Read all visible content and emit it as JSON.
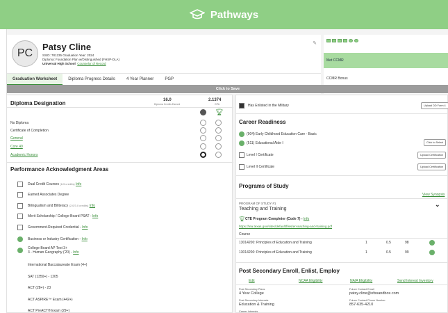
{
  "app": {
    "title": "Pathways"
  },
  "profile": {
    "initials": "PC",
    "name": "Patsy Cline",
    "line1": "SSID: 781235  Graduation Year: 2024",
    "line2": "Diploma: Foundation Plan w/Distinguished (FHSP-DLA)",
    "line3": "Universal High School",
    "counselor": "Counselor of Record"
  },
  "tabs": [
    "Graduation Worksheet",
    "Diploma Progress Details",
    "4 Year Planner",
    "PGP"
  ],
  "ccmr": {
    "met": "Met CCMR",
    "bonus": "CCMR Bonus"
  },
  "save": "Click to Save",
  "diploma": {
    "title": "Diploma Designation",
    "credits": "16.0",
    "credits_label": "Diploma Credits Earned",
    "gpa": "2.1374",
    "gpa_label": "GPA",
    "options": [
      "No Diploma",
      "Certificate of Completion",
      "General",
      "Core 40",
      "Academic Honors"
    ]
  },
  "pa": {
    "title": "Performance Acknowledgment Areas",
    "items": [
      {
        "label": "Dual Credit Courses",
        "sub": "(6.5 credits)",
        "link": "Info"
      },
      {
        "label": "Earned Associates Degree",
        "sub": "",
        "link": ""
      },
      {
        "label": "Bilingualism and Biliteracy",
        "sub": "(2.0/3.0 credits)",
        "link": "Info"
      },
      {
        "label": "Merit Scholarship / College Board PSAT -",
        "sub": "",
        "link": "Info"
      },
      {
        "label": "Government-Required Credential -",
        "sub": "",
        "link": "Info"
      },
      {
        "label": "Business or Industry Certification -",
        "sub": "",
        "link": "Info"
      },
      {
        "label": "College Board AP Test 3+",
        "sub": "",
        "link": ""
      },
      {
        "label": "3 - Human Geography ('20) -",
        "sub": "",
        "link": "Info"
      },
      {
        "label": "International Baccalaureate Exam (4+)",
        "sub": "",
        "link": ""
      },
      {
        "label": "SAT (1350+) - 1205",
        "sub": "",
        "link": ""
      },
      {
        "label": "ACT (28+) - 23",
        "sub": "",
        "link": ""
      },
      {
        "label": "ACT ASPIRE™ Exam (442+)",
        "sub": "",
        "link": ""
      },
      {
        "label": "ACT PreACT® Exam (29+)",
        "sub": "",
        "link": ""
      }
    ]
  },
  "military": "Has Enlisted in the Military",
  "upload_button": "Upload DD Form 4",
  "career": {
    "title": "Career Readiness",
    "items": [
      "(904) Early Childhood Education Care - Basic",
      "(511) Educational Aide I"
    ],
    "select_button": "Click to Select",
    "levels": [
      "Level I Certificate",
      "Level II Certificate"
    ],
    "upload_cert": "Upload Certification"
  },
  "programs": {
    "title": "Programs of Study",
    "synopsis": "View Synopsis",
    "program_label": "PROGRAM OF STUDY #1",
    "program_name": "Teaching and Training",
    "cte": "CTE Program Completer (Code 7) -",
    "cte_link": "Info",
    "url": "https://tea.texas.gov/sites/default/files/er-teaching-and-training.pdf",
    "course_header": "Course",
    "courses": [
      {
        "name": "13014200: Principles of Education and Training",
        "c1": "1",
        "c2": "0.5",
        "c3": "98"
      },
      {
        "name": "13014200: Principles of Education and Training",
        "c1": "1",
        "c2": "0.5",
        "c3": "99"
      }
    ]
  },
  "post": {
    "title": "Post Secondary Enroll, Enlist, Employ",
    "links": [
      "Edit",
      "NCAA Eligibility",
      "NAIA Eligibility",
      "Send Interest Inventory"
    ],
    "plans_label": "Post Secondary Plans",
    "plans": "4 Year College",
    "email_label": "Future Contact Email",
    "email": "patsy.cline@ofssandbox.com",
    "interests_label": "Post Secondary Interests",
    "interests": "Education & Training",
    "phone_label": "Future Contact Phone Number",
    "phone": "857-635-4210",
    "career_label": "Career Interests"
  },
  "colors": {
    "brand": "#8fcf85",
    "accent": "#3a8f3a"
  }
}
